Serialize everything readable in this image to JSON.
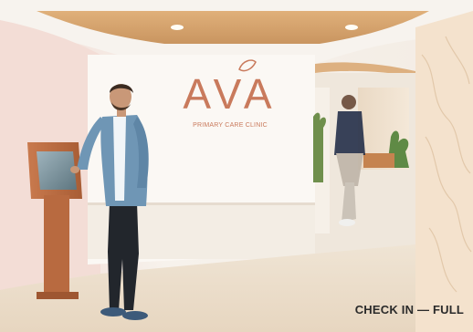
{
  "logo": {
    "wordmark": "AVA",
    "tagline": "PRIMARY CARE CLINIC"
  },
  "caption": "CHECK IN — FULL",
  "colors": {
    "brand": "#c97a5c",
    "kiosk_wood": "#b86a40",
    "ceiling_wood": "#d4a06b",
    "wall": "#f2ede7",
    "floor": "#efe4d4",
    "shirt": "#6f96b5",
    "jeans": "#22262c"
  },
  "icons": {
    "logo_mark": "leaf-icon"
  }
}
